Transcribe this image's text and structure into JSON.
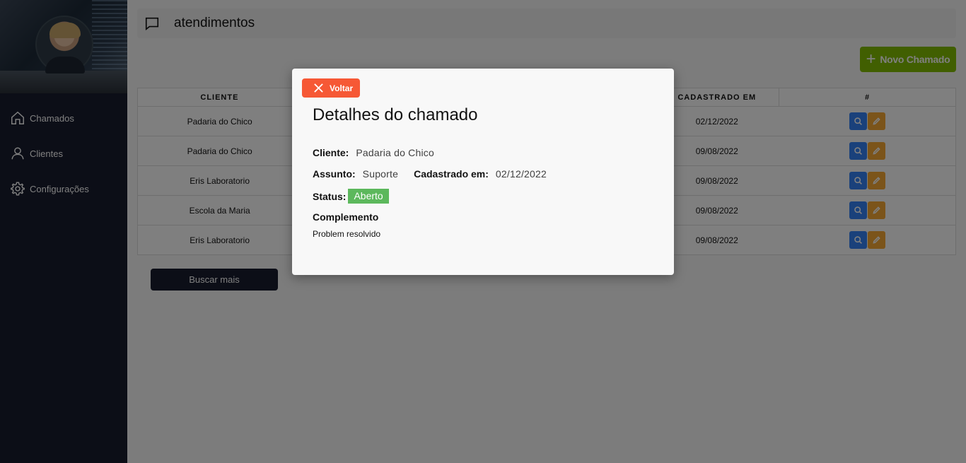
{
  "sidebar": {
    "items": [
      {
        "label": "Chamados",
        "icon": "home-icon"
      },
      {
        "label": "Clientes",
        "icon": "user-icon"
      },
      {
        "label": "Configurações",
        "icon": "gear-icon"
      }
    ]
  },
  "header": {
    "title": "atendimentos",
    "icon": "chat-icon"
  },
  "new_button": {
    "label": "Novo Chamado",
    "icon": "plus-icon"
  },
  "table": {
    "headers": {
      "client": "CLIENTE",
      "date": "CADASTRADO EM",
      "actions": "#"
    },
    "rows": [
      {
        "client": "Padaria do Chico",
        "date": "02/12/2022"
      },
      {
        "client": "Padaria do Chico",
        "date": "09/08/2022"
      },
      {
        "client": "Eris Laboratorio",
        "date": "09/08/2022"
      },
      {
        "client": "Escola da Maria",
        "date": "09/08/2022"
      },
      {
        "client": "Eris Laboratorio",
        "date": "09/08/2022"
      }
    ]
  },
  "more_button": {
    "label": "Buscar mais"
  },
  "modal": {
    "close_label": "Voltar",
    "title": "Detalhes do chamado",
    "client_label": "Cliente:",
    "client_value": "Padaria do Chico",
    "subject_label": "Assunto:",
    "subject_value": "Suporte",
    "created_label": "Cadastrado em:",
    "created_value": "02/12/2022",
    "status_label": "Status:",
    "status_value": "Aberto",
    "complement_label": "Complemento",
    "complement_value": "Problem resolvido"
  },
  "colors": {
    "sidebar": "#181c2e",
    "new_button": "#83bf02",
    "search_button": "#3583f6",
    "edit_button": "#f6a935",
    "close_button": "#f65835",
    "status_open": "#5cb85c"
  }
}
